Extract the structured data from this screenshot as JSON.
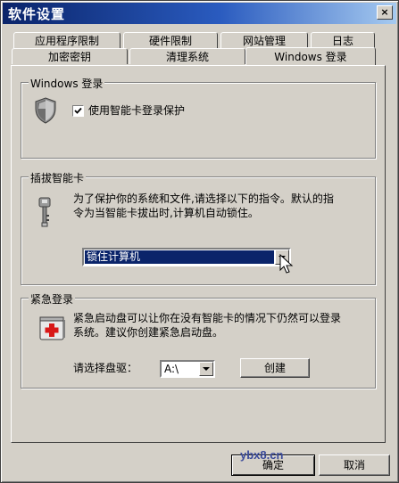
{
  "window": {
    "title": "软件设置",
    "close_glyph": "×"
  },
  "tabs": {
    "row1": [
      "应用程序限制",
      "硬件限制",
      "网站管理",
      "日志"
    ],
    "row2": [
      "加密密钥",
      "清理系统",
      "Windows 登录"
    ],
    "active": "Windows 登录"
  },
  "windows_login": {
    "legend": "Windows 登录",
    "checkbox_label": "使用智能卡登录保护",
    "checkbox_checked": true,
    "icon": "shield-icon"
  },
  "smartcard": {
    "legend": "插拔智能卡",
    "description_line1": "为了保护你的系统和文件,请选择以下的指令。默认的指",
    "description_line2": "令为当智能卡拔出时,计算机自动锁住。",
    "action_value": "锁住计算机",
    "icon": "key-icon"
  },
  "emergency": {
    "legend": "紧急登录",
    "description_line1": "紧急启动盘可以让你在没有智能卡的情况下仍然可以登录",
    "description_line2": "系统。建议你创建紧急启动盘。",
    "drive_label": "请选择盘驱：",
    "drive_value": "A:\\",
    "create_label": "创建",
    "icon": "first-aid-icon"
  },
  "footer": {
    "ok_label": "确定",
    "cancel_label": "取消"
  },
  "watermark": "ybx8.cn",
  "colors": {
    "titlebar_start": "#0a246a",
    "titlebar_end": "#a6caf0",
    "face": "#d4d0c8",
    "selection": "#0a246a"
  }
}
